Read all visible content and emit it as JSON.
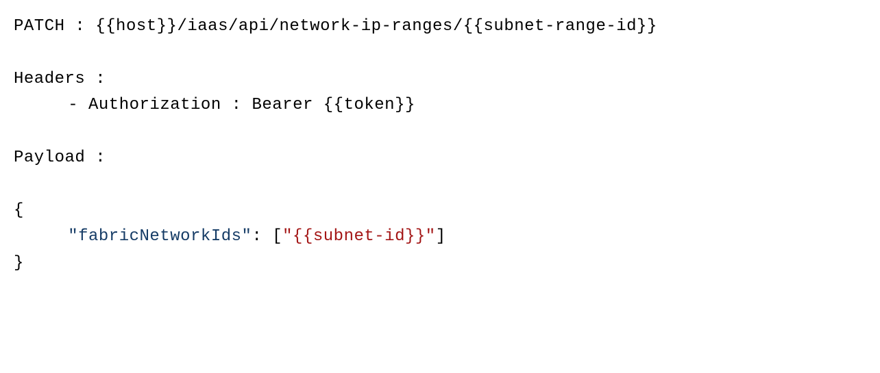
{
  "request": {
    "methodLabel": "PATCH",
    "colonSep": " : ",
    "url": "{{host}}/iaas/api/network-ip-ranges/{{subnet-range-id}}"
  },
  "headers": {
    "label": "Headers :",
    "items": [
      {
        "bullet": "- ",
        "name": "Authorization",
        "sep": " : ",
        "value": "Bearer {{token}}"
      }
    ]
  },
  "payload": {
    "label": "Payload :",
    "openBrace": "{",
    "closeBrace": "}",
    "entries": [
      {
        "keyQuoted": "\"fabricNetworkIds\"",
        "sep": ": ",
        "openBracket": "[",
        "valueQuoted": "\"{{subnet-id}}\"",
        "closeBracket": "]"
      }
    ]
  }
}
